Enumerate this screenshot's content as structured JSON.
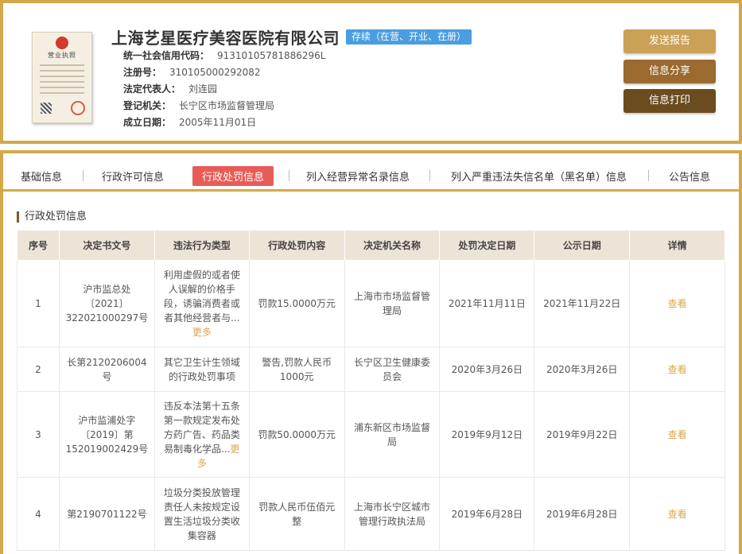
{
  "company": {
    "name": "上海艺星医疗美容医院有限公司",
    "status": "存续（在营、开业、在册）",
    "license_title": "营业执照",
    "fields": [
      {
        "label": "统一社会信用代码：",
        "value": "91310105781886296L"
      },
      {
        "label": "注册号：",
        "value": "310105000292082"
      },
      {
        "label": "法定代表人：",
        "value": "刘连园"
      },
      {
        "label": "登记机关：",
        "value": "长宁区市场监督管理局"
      },
      {
        "label": "成立日期：",
        "value": "2005年11月01日"
      }
    ]
  },
  "actions": {
    "report": "发送报告",
    "share": "信息分享",
    "print": "信息打印"
  },
  "tabs": [
    {
      "label": "基础信息"
    },
    {
      "label": "行政许可信息"
    },
    {
      "label": "行政处罚信息"
    },
    {
      "label": "列入经营异常名录信息"
    },
    {
      "label": "列入严重违法失信名单（黑名单）信息"
    },
    {
      "label": "公告信息"
    }
  ],
  "section": {
    "title": "行政处罚信息"
  },
  "table": {
    "headers": [
      "序号",
      "决定书文号",
      "违法行为类型",
      "行政处罚内容",
      "决定机关名称",
      "处罚决定日期",
      "公示日期",
      "详情"
    ],
    "more_label": "更多",
    "rows": [
      {
        "no": "1",
        "doc": "沪市监总处〔2021〕322021000297号",
        "type": "利用虚假的或者使人误解的价格手段，诱骗消费者或者其他经营者与...",
        "content": "罚款15.0000万元",
        "authority": "上海市市场监督管理局",
        "decision_date": "2021年11月11日",
        "publish_date": "2021年11月22日",
        "view": "查看"
      },
      {
        "no": "2",
        "doc": "长第2120206004号",
        "type": "其它卫生计生领域的行政处罚事项",
        "content": "警告,罚款人民币1000元",
        "authority": "长宁区卫生健康委员会",
        "decision_date": "2020年3月26日",
        "publish_date": "2020年3月26日",
        "view": "查看"
      },
      {
        "no": "3",
        "doc": "沪市监浦处字〔2019〕第152019002429号",
        "type": "违反本法第十五条第一款规定发布处方药广告、药品类易制毒化学品...",
        "content": "罚款50.0000万元",
        "authority": "浦东新区市场监督局",
        "decision_date": "2019年9月12日",
        "publish_date": "2019年9月22日",
        "view": "查看"
      },
      {
        "no": "4",
        "doc": "第2190701122号",
        "type": "垃圾分类投放管理责任人未按规定设置生活垃圾分类收集容器",
        "content": "罚款人民币伍佰元整",
        "authority": "上海市长宁区城市管理行政执法局",
        "decision_date": "2019年6月28日",
        "publish_date": "2019年6月28日",
        "view": "查看"
      }
    ]
  },
  "colors": {
    "frame": "#d3a84a",
    "active_tab": "#e85c57",
    "status_badge": "#4a9de0",
    "link": "#d9a74c"
  }
}
